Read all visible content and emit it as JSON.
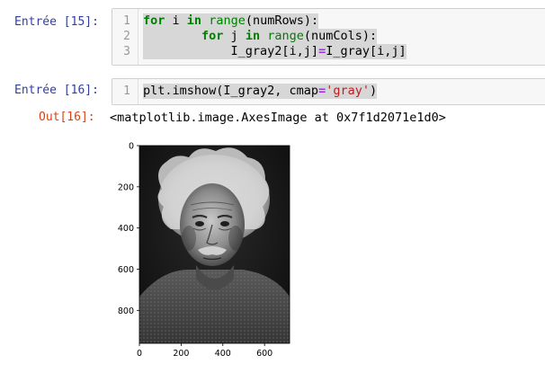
{
  "cells": [
    {
      "prompt": "Entrée [15]:",
      "lines": [
        {
          "num": "1",
          "tokens": [
            {
              "t": "for",
              "c": "kw"
            },
            {
              "t": " i ",
              "c": ""
            },
            {
              "t": "in",
              "c": "kw"
            },
            {
              "t": " ",
              "c": ""
            },
            {
              "t": "range",
              "c": "bi"
            },
            {
              "t": "(numRows):",
              "c": ""
            }
          ]
        },
        {
          "num": "2",
          "tokens": [
            {
              "t": "        ",
              "c": ""
            },
            {
              "t": "for",
              "c": "kw"
            },
            {
              "t": " j ",
              "c": ""
            },
            {
              "t": "in",
              "c": "kw"
            },
            {
              "t": " ",
              "c": ""
            },
            {
              "t": "range",
              "c": "bi"
            },
            {
              "t": "(numCols):",
              "c": ""
            }
          ]
        },
        {
          "num": "3",
          "tokens": [
            {
              "t": "            I_gray2[i,j]",
              "c": ""
            },
            {
              "t": "=",
              "c": "op"
            },
            {
              "t": "I_gray[i,j]",
              "c": ""
            }
          ]
        }
      ]
    },
    {
      "prompt": "Entrée [16]:",
      "lines": [
        {
          "num": "1",
          "tokens": [
            {
              "t": "plt.imshow(I_gray2, cmap",
              "c": ""
            },
            {
              "t": "=",
              "c": "op"
            },
            {
              "t": "'gray'",
              "c": "str"
            },
            {
              "t": ")",
              "c": ""
            }
          ]
        }
      ],
      "out_prompt": "Out[16]:",
      "out_text": "<matplotlib.image.AxesImage at 0x7f1d2071e1d0>"
    }
  ],
  "plot": {
    "image_description": "Grayscale portrait photograph",
    "y_ticks": [
      "0",
      "200",
      "400",
      "600",
      "800"
    ],
    "x_ticks": [
      "0",
      "200",
      "400",
      "600"
    ],
    "xlim": [
      0,
      720
    ],
    "ylim": [
      0,
      960
    ]
  }
}
